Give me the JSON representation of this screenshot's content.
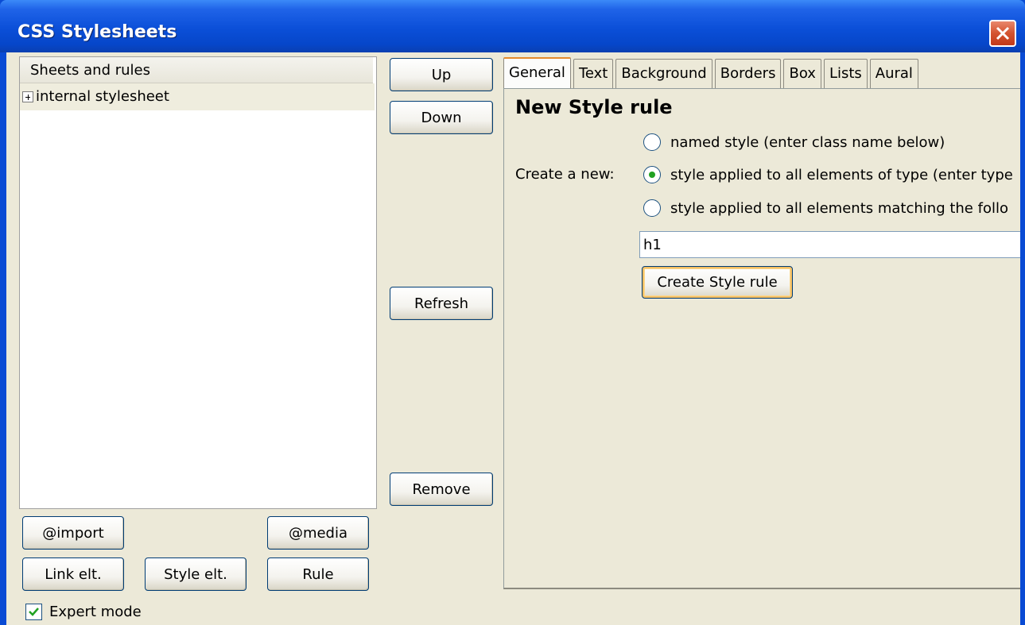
{
  "window": {
    "title": "CSS Stylesheets"
  },
  "tree": {
    "header": "Sheets and rules",
    "items": [
      {
        "label": "internal stylesheet",
        "expanded": false
      }
    ]
  },
  "middle_buttons": {
    "up": "Up",
    "down": "Down",
    "refresh": "Refresh",
    "remove": "Remove"
  },
  "left_buttons": {
    "import": "@import",
    "media": "@media",
    "link": "Link elt.",
    "style": "Style elt.",
    "rule": "Rule"
  },
  "expert_mode": {
    "label": "Expert mode",
    "checked": true
  },
  "tabs": [
    "General",
    "Text",
    "Background",
    "Borders",
    "Box",
    "Lists",
    "Aural"
  ],
  "active_tab": "General",
  "general": {
    "heading": "New Style rule",
    "create_label": "Create a new:",
    "options": [
      "named style (enter class name below)",
      "style applied to all elements of type (enter type",
      "style applied to all elements matching the follo"
    ],
    "selected_option": 1,
    "input_value": "h1",
    "create_button": "Create Style rule"
  },
  "colors": {
    "title_bar": "#0a4bd4",
    "dialog_bg": "#ece9d8",
    "active_tab_accent": "#e68b2c",
    "radio_dot": "#21a121"
  }
}
